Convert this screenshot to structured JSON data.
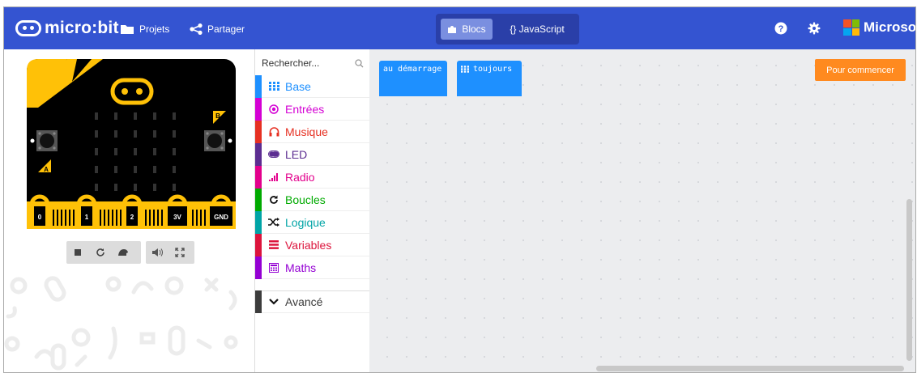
{
  "header": {
    "logo_text": "micro:bit",
    "projects_label": "Projets",
    "share_label": "Partager",
    "mode_blocks_label": "Blocs",
    "mode_js_label": "{} JavaScript",
    "microsoft_label": "Microsoft",
    "colors": {
      "header_bg": "#3454d1",
      "mode_active": "#7a8fe0"
    }
  },
  "simulator": {
    "pin_labels": [
      "0",
      "1",
      "2",
      "3V",
      "GND"
    ],
    "button_a": "A",
    "button_b": "B",
    "controls": [
      "stop-icon",
      "restart-icon",
      "slowmo-icon",
      "mute-icon",
      "fullscreen-icon"
    ]
  },
  "toolbox": {
    "search_placeholder": "Rechercher...",
    "categories": [
      {
        "label": "Base",
        "color": "#1e90ff",
        "icon": "grid-icon"
      },
      {
        "label": "Entrées",
        "color": "#d400d4",
        "icon": "input-circle-icon"
      },
      {
        "label": "Musique",
        "color": "#e63022",
        "icon": "headphones-icon"
      },
      {
        "label": "LED",
        "color": "#5c2d91",
        "icon": "toggle-icon"
      },
      {
        "label": "Radio",
        "color": "#e3008c",
        "icon": "signal-bars-icon"
      },
      {
        "label": "Boucles",
        "color": "#00aa00",
        "icon": "refresh-icon"
      },
      {
        "label": "Logique",
        "color": "#00a4a6",
        "icon": "shuffle-icon"
      },
      {
        "label": "Variables",
        "color": "#dc143c",
        "icon": "lines-icon"
      },
      {
        "label": "Maths",
        "color": "#9400d3",
        "icon": "calculator-icon"
      }
    ],
    "advanced": {
      "label": "Avancé",
      "color": "#3c3c3c",
      "icon": "chevron-down-icon"
    }
  },
  "workspace": {
    "block_start_label": "au démarrage",
    "block_forever_label": "toujours",
    "get_started_label": "Pour commencer"
  }
}
